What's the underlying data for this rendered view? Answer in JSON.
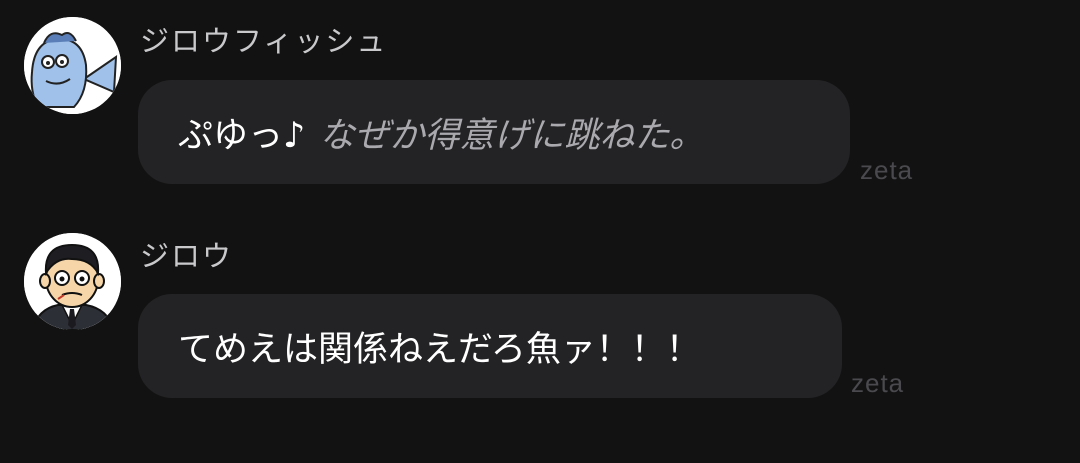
{
  "messages": [
    {
      "sender": "ジロウフィッシュ",
      "avatar": "fish-character-avatar",
      "speech": "ぷゆっ♪",
      "action": "なぜか得意げに跳ねた。",
      "brand": "zeta"
    },
    {
      "sender": "ジロウ",
      "avatar": "man-in-suit-avatar",
      "speech": "てめえは関係ねえだろ魚ァ！！！",
      "action": "",
      "brand": "zeta"
    }
  ],
  "colors": {
    "background": "#121213",
    "bubble": "#232325",
    "sender_text": "#c9c9cc",
    "message_text": "#ffffff",
    "action_text": "#a9a9ae",
    "brand_text": "#4a4a4e"
  }
}
